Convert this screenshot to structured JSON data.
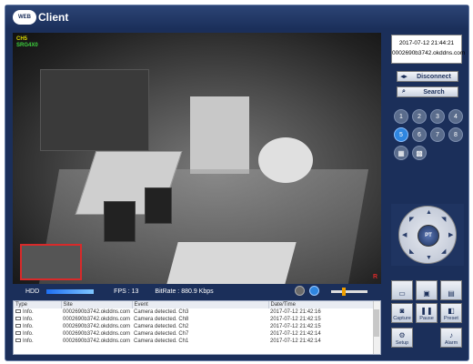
{
  "app": {
    "title": "Client",
    "logo_badge": "WEB"
  },
  "video": {
    "osd_line1": "CH5",
    "osd_line2": "SRG4X0",
    "rec_mark": "R"
  },
  "statusbar": {
    "hdd_label": "HDD",
    "fps_label": "FPS : 13",
    "bitrate_label": "BitRate : 880.9 Kbps",
    "volume_level": 0.35
  },
  "log": {
    "columns": [
      "Type",
      "Site",
      "Event",
      "Date/Time"
    ],
    "rows": [
      {
        "type": "Info.",
        "site": "0002690b3742.okddns.com",
        "event": "Camera detected. Ch3",
        "datetime": "2017-07-12 21:42:16"
      },
      {
        "type": "Info.",
        "site": "0002690b3742.okddns.com",
        "event": "Camera detected. Ch8",
        "datetime": "2017-07-12 21:42:15"
      },
      {
        "type": "Info.",
        "site": "0002690b3742.okddns.com",
        "event": "Camera detected. Ch2",
        "datetime": "2017-07-12 21:42:15"
      },
      {
        "type": "Info.",
        "site": "0002690b3742.okddns.com",
        "event": "Camera detected. Ch7",
        "datetime": "2017-07-12 21:42:14"
      },
      {
        "type": "Info.",
        "site": "0002690b3742.okddns.com",
        "event": "Camera detected. Ch1",
        "datetime": "2017-07-12 21:42:14"
      }
    ]
  },
  "side": {
    "clock": "2017-07-12 21:44:21",
    "site": "0002690b3742.okddns.com",
    "disconnect_label": "Disconnect",
    "search_label": "Search",
    "channels": [
      "1",
      "2",
      "3",
      "4",
      "5",
      "6",
      "7",
      "8"
    ],
    "active_channel": "5",
    "ptz_label": "PT",
    "tools": {
      "capture": "Capture",
      "pause": "Pause",
      "preset": "Preset",
      "setup": "Setup",
      "alarm": "Alarm"
    }
  },
  "colors": {
    "frame": "#1b2f5a",
    "active_channel": "#2f86e0",
    "record": "#d82a2a"
  }
}
